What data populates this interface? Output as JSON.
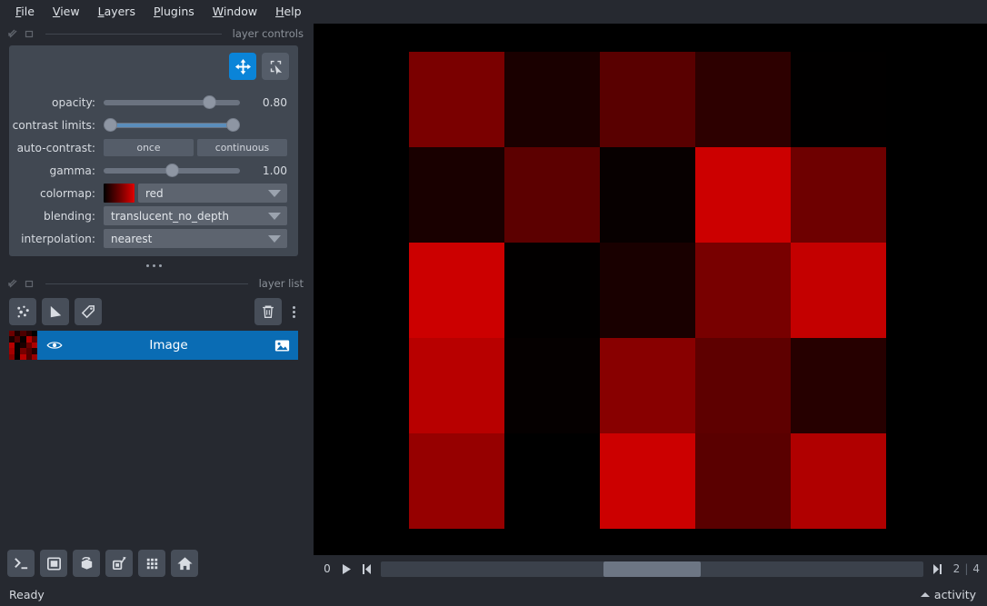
{
  "menu": {
    "items": [
      {
        "label": "File",
        "mnemonic": "F"
      },
      {
        "label": "View",
        "mnemonic": "V"
      },
      {
        "label": "Layers",
        "mnemonic": "L"
      },
      {
        "label": "Plugins",
        "mnemonic": "P"
      },
      {
        "label": "Window",
        "mnemonic": "W"
      },
      {
        "label": "Help",
        "mnemonic": "H"
      }
    ]
  },
  "layer_controls": {
    "panel_title": "layer controls",
    "mode_buttons": [
      {
        "name": "pan-zoom",
        "active": true
      },
      {
        "name": "transform",
        "active": false
      }
    ],
    "opacity": {
      "label": "opacity:",
      "value": "0.80",
      "percent": 80
    },
    "contrast_limits": {
      "label": "contrast limits:",
      "low_percent": 0,
      "high_percent": 100
    },
    "auto_contrast": {
      "label": "auto-contrast:",
      "once": "once",
      "continuous": "continuous"
    },
    "gamma": {
      "label": "gamma:",
      "value": "1.00",
      "percent": 50
    },
    "colormap": {
      "label": "colormap:",
      "value": "red"
    },
    "blending": {
      "label": "blending:",
      "value": "translucent_no_depth"
    },
    "interpolation": {
      "label": "interpolation:",
      "value": "nearest"
    }
  },
  "layer_list": {
    "panel_title": "layer list",
    "tools": [
      {
        "name": "new-points-layer"
      },
      {
        "name": "new-shapes-layer"
      },
      {
        "name": "new-labels-layer"
      }
    ],
    "delete_label": "delete-layer",
    "layers": [
      {
        "name": "Image",
        "visible": true,
        "selected": true,
        "type": "image"
      }
    ]
  },
  "bottom_toolbar": {
    "buttons": [
      {
        "name": "console-button"
      },
      {
        "name": "ndisplay-toggle-button"
      },
      {
        "name": "roll-dimensions-button"
      },
      {
        "name": "transpose-dimensions-button"
      },
      {
        "name": "grid-view-button"
      },
      {
        "name": "home-reset-button"
      }
    ]
  },
  "status": {
    "text": "Ready",
    "activity_label": "activity"
  },
  "dim_slider": {
    "axis_label": "0",
    "current": "2",
    "max": "4",
    "separator": "|",
    "position_percent": 50
  },
  "chart_data": {
    "type": "heatmap",
    "title": "",
    "rows": 5,
    "cols": 5,
    "colormap": "red",
    "grid": [
      [
        "#7a0000",
        "#1a0000",
        "#590000",
        "#2d0000",
        "#010000"
      ],
      [
        "#190000",
        "#5c0000",
        "#070000",
        "#cc0000",
        "#6e0000"
      ],
      [
        "#cc0000",
        "#020000",
        "#190000",
        "#780000",
        "#c40000"
      ],
      [
        "#b80000",
        "#050000",
        "#880000",
        "#5e0000",
        "#260000"
      ],
      [
        "#960000",
        "#000000",
        "#cc0000",
        "#5a0000",
        "#b00000"
      ]
    ],
    "thumbnail_grid": [
      [
        "#6d0000",
        "#1d0000",
        "#4d0000",
        "#280000",
        "#050000"
      ],
      [
        "#1c0000",
        "#520000",
        "#090000",
        "#b60000",
        "#620000"
      ],
      [
        "#b60000",
        "#040000",
        "#1c0000",
        "#6a0000",
        "#ae0000"
      ],
      [
        "#a40000",
        "#060000",
        "#780000",
        "#540000",
        "#240000"
      ],
      [
        "#860000",
        "#010000",
        "#b60000",
        "#500000",
        "#9c0000"
      ]
    ]
  },
  "colors": {
    "window_bg": "#262930",
    "panel_bg": "#414852",
    "accent_blue": "#0a84d8",
    "selected_row": "#0a6cb4",
    "text": "#d0d4da",
    "muted_text": "#8b9199"
  }
}
